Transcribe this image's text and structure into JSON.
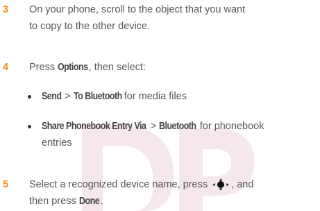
{
  "watermark": {
    "text": "DP",
    "color": "#f4e8ea"
  },
  "accent_color": "#f28c1c",
  "steps": [
    {
      "number": "3",
      "line1": "On your phone, scroll to the object that you want",
      "line2": "to copy to the other device."
    },
    {
      "number": "4",
      "pre": "Press ",
      "key": "Options",
      "post": ", then select:",
      "bullets": [
        {
          "k1": "Send",
          "sep": " > ",
          "k2": "To Bluetooth",
          "rest": " for media files"
        },
        {
          "k1": "Share Phonebook Entry Via",
          "sep": " > ",
          "k2": "Bluetooth",
          "rest": " for phonebook",
          "line2": "entries"
        }
      ]
    },
    {
      "number": "5",
      "pre": "Select a recognized device name, press ",
      "icon": "nav-key-center-icon",
      "post": ", and",
      "line2_pre": "then press ",
      "line2_key": "Done",
      "line2_post": "."
    }
  ]
}
